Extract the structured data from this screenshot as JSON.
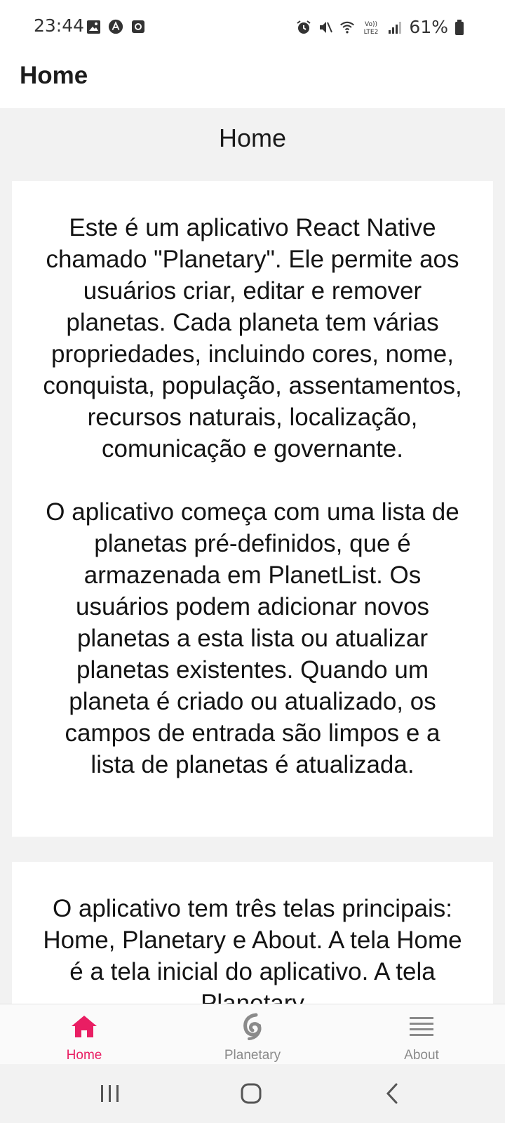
{
  "status_bar": {
    "time": "23:44",
    "battery": "61%",
    "icons": [
      "image-icon",
      "app-icon",
      "record-icon",
      "alarm-icon",
      "mute-icon",
      "wifi-icon",
      "volte-lte2-icon",
      "signal-icon",
      "battery-icon"
    ],
    "volte_label": "VoLTE2"
  },
  "header": {
    "title": "Home"
  },
  "main": {
    "heading": "Home",
    "cards": [
      {
        "paragraphs": [
          "Este é um aplicativo React Native chamado \"Planetary\". Ele permite aos usuários criar, editar e remover planetas. Cada planeta tem várias propriedades, incluindo cores, nome, conquista, população, assentamentos, recursos naturais, localização, comunicação e governante.",
          "O aplicativo começa com uma lista de planetas pré-definidos, que é armazenada em PlanetList. Os usuários podem adicionar novos planetas a esta lista ou atualizar planetas existentes. Quando um planeta é criado ou atualizado, os campos de entrada são limpos e a lista de planetas é atualizada."
        ]
      },
      {
        "paragraphs": [
          "O aplicativo tem três telas principais: Home, Planetary e About. A tela Home é a tela inicial do aplicativo. A tela Planetary"
        ]
      }
    ]
  },
  "tabs": [
    {
      "label": "Home",
      "icon": "home-icon",
      "active": true
    },
    {
      "label": "Planetary",
      "icon": "planet-swirl-icon",
      "active": false
    },
    {
      "label": "About",
      "icon": "menu-lines-icon",
      "active": false
    }
  ],
  "colors": {
    "accent": "#e91e63",
    "inactive": "#8a8a8a",
    "background": "#f2f2f2",
    "card": "#ffffff"
  },
  "system_nav": {
    "buttons": [
      "recents-icon",
      "home-circle-icon",
      "back-icon"
    ]
  }
}
